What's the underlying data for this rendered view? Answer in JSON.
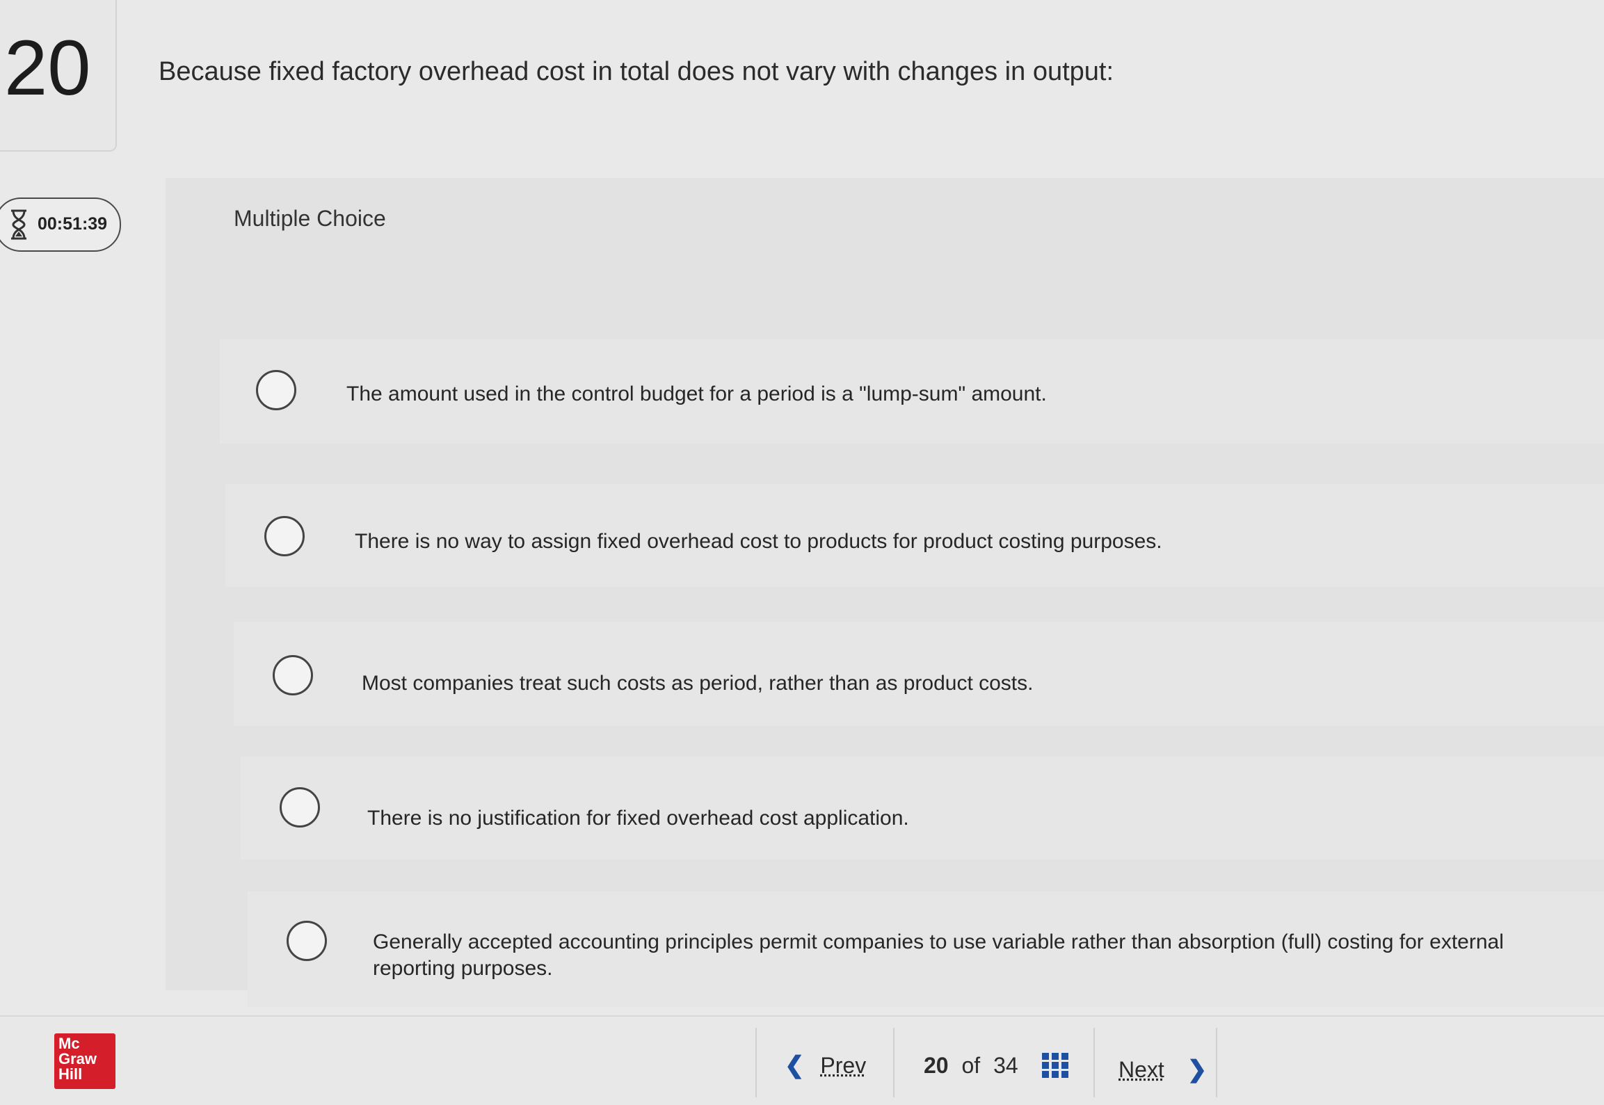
{
  "question": {
    "number": "20",
    "prompt": "Because fixed factory overhead cost in total does not vary with changes in output:"
  },
  "timer": {
    "value": "00:51:39",
    "icon": "hourglass-icon"
  },
  "question_type": "Multiple Choice",
  "choices": [
    {
      "text": "The amount used in the control budget for a period is a \"lump-sum\" amount."
    },
    {
      "text": "There is no way to assign fixed overhead cost to products for product costing purposes."
    },
    {
      "text": "Most companies treat such costs as period, rather than as product costs."
    },
    {
      "text": "There is no justification for fixed overhead cost application."
    },
    {
      "text": "Generally accepted accounting principles permit companies to use variable rather than absorption (full) costing for external reporting purposes."
    }
  ],
  "footer": {
    "logo_lines": [
      "Mc",
      "Graw",
      "Hill"
    ],
    "prev_label": "Prev",
    "next_label": "Next",
    "current_page": "20",
    "of_label": "of",
    "total_pages": "34"
  },
  "colors": {
    "accent": "#1f4fa0",
    "logo": "#d41f2b"
  }
}
